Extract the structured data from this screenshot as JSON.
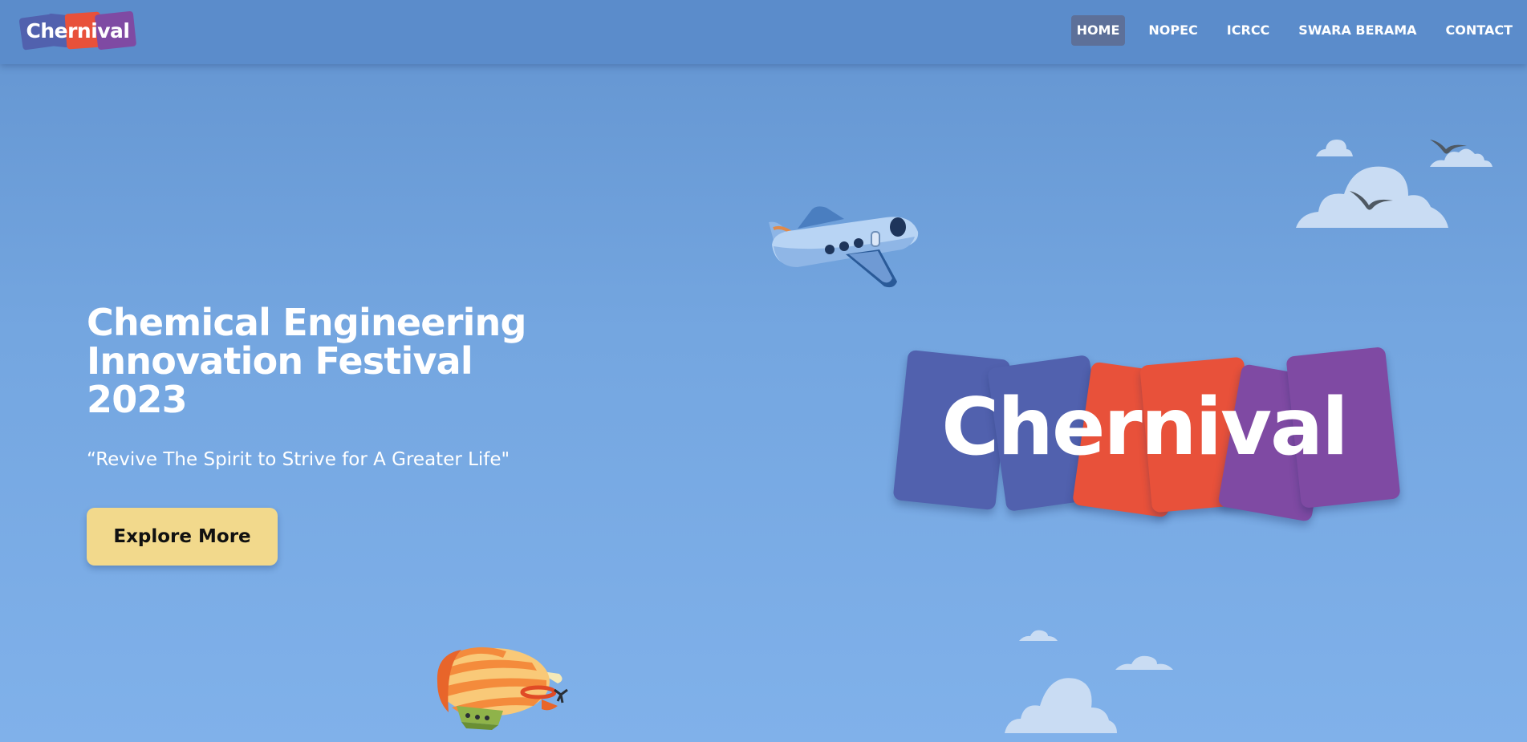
{
  "brand": {
    "logo_text": "Chernival",
    "colors": {
      "indigo": "#5161ae",
      "red": "#e8513a",
      "purple": "#7f4aa3"
    }
  },
  "nav": {
    "items": [
      {
        "label": "HOME",
        "active": true
      },
      {
        "label": "NOPEC",
        "active": false
      },
      {
        "label": "ICRCC",
        "active": false
      },
      {
        "label": "SWARA BERAMA",
        "active": false
      },
      {
        "label": "CONTACT",
        "active": false
      }
    ]
  },
  "hero": {
    "title": "Chemical Engineering Innovation Festival 2023",
    "subtitle": "“Revive The Spirit to Strive for A Greater Life\"",
    "cta_label": "Explore More",
    "cta_color": "#f2d98c"
  },
  "illustrations": [
    "airplane-illustration",
    "airship-illustration",
    "cloud-icon",
    "bird-icon"
  ]
}
